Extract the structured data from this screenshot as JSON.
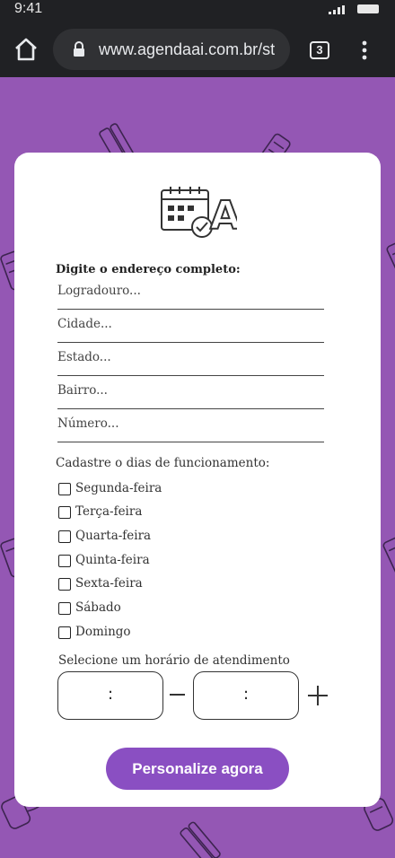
{
  "status_bar": {
    "time": "9:41"
  },
  "browser": {
    "url": "www.agendaai.com.br/st",
    "tab_count": "3"
  },
  "logo": {
    "text": "AI"
  },
  "address": {
    "title": "Digite o endereço completo:",
    "fields": [
      {
        "placeholder": "Logradouro..."
      },
      {
        "placeholder": "Cidade..."
      },
      {
        "placeholder": "Estado..."
      },
      {
        "placeholder": "Bairro..."
      },
      {
        "placeholder": "Número..."
      }
    ]
  },
  "days": {
    "title": "Cadastre o dias de funcionamento:",
    "items": [
      {
        "label": "Segunda-feira",
        "checked": false
      },
      {
        "label": "Terça-feira",
        "checked": false
      },
      {
        "label": "Quarta-feira",
        "checked": false
      },
      {
        "label": "Quinta-feira",
        "checked": false
      },
      {
        "label": "Sexta-feira",
        "checked": false
      },
      {
        "label": "Sábado",
        "checked": false
      },
      {
        "label": "Domingo",
        "checked": false
      }
    ]
  },
  "hours": {
    "title": "Selecione um horário de atendimento",
    "start_separator": ":",
    "end_separator": ":"
  },
  "cta": {
    "label": "Personalize agora"
  },
  "colors": {
    "background": "#9457b4",
    "button": "#8a4fc2",
    "card": "#ffffff"
  }
}
